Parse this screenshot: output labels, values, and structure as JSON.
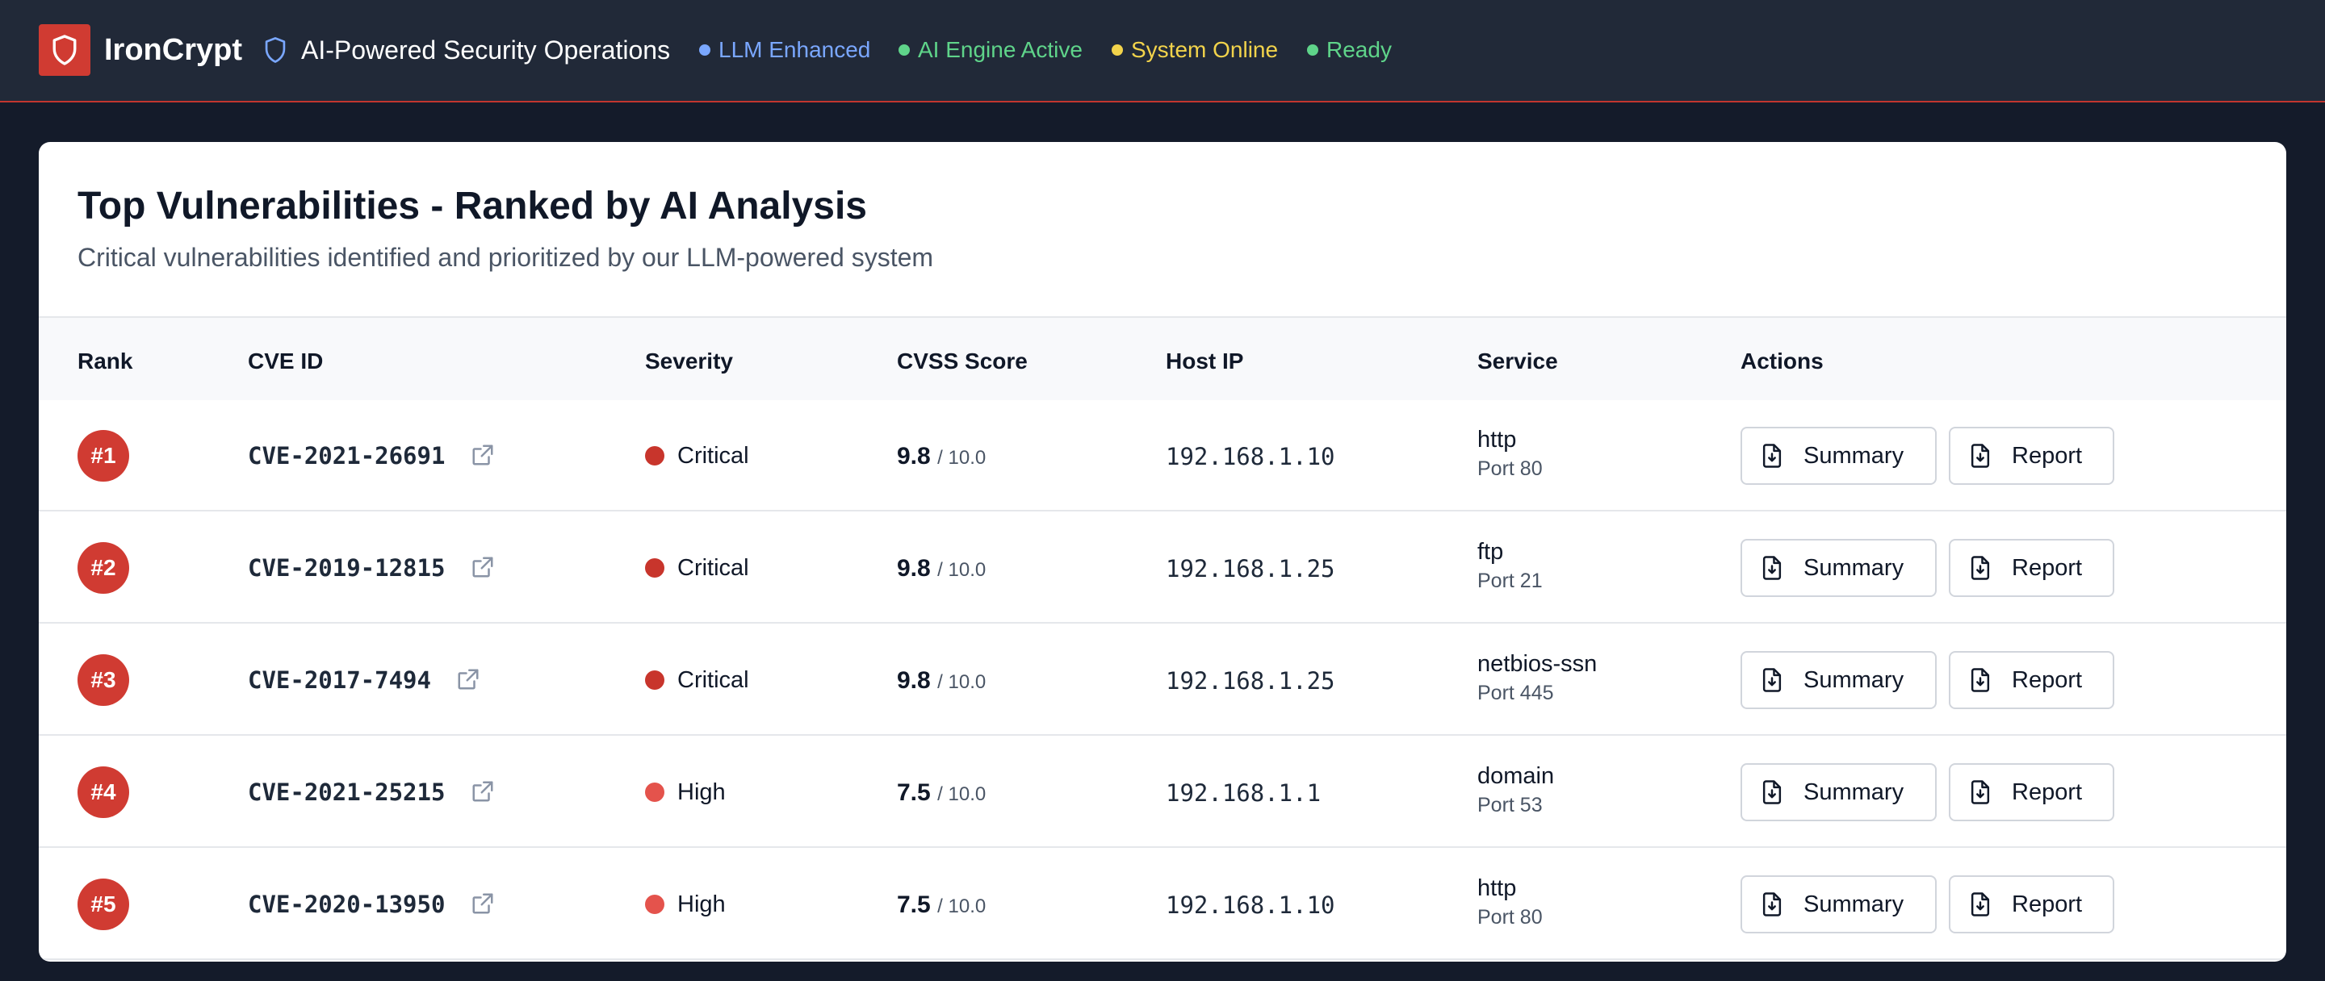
{
  "header": {
    "brand": "IronCrypt",
    "tagline": "AI-Powered Security Operations",
    "statuses": [
      {
        "label": "LLM Enhanced",
        "color": "#7aa7ff"
      },
      {
        "label": "AI Engine Active",
        "color": "#5fd48a"
      },
      {
        "label": "System Online",
        "color": "#f2d34b"
      },
      {
        "label": "Ready",
        "color": "#5fd48a"
      }
    ]
  },
  "card": {
    "title": "Top Vulnerabilities - Ranked by AI Analysis",
    "subtitle": "Critical vulnerabilities identified and prioritized by our LLM-powered system"
  },
  "table": {
    "columns": [
      "Rank",
      "CVE ID",
      "Severity",
      "CVSS Score",
      "Host IP",
      "Service",
      "Actions"
    ],
    "rows": [
      {
        "rank": "#1",
        "cve": "CVE-2021-26691",
        "severity": "Critical",
        "severity_color": "#c8352c",
        "score": "9.8",
        "max": "/ 10.0",
        "ip": "192.168.1.10",
        "service": "http",
        "port": "Port 80",
        "summary": "Summary",
        "report": "Report"
      },
      {
        "rank": "#2",
        "cve": "CVE-2019-12815",
        "severity": "Critical",
        "severity_color": "#c8352c",
        "score": "9.8",
        "max": "/ 10.0",
        "ip": "192.168.1.25",
        "service": "ftp",
        "port": "Port 21",
        "summary": "Summary",
        "report": "Report"
      },
      {
        "rank": "#3",
        "cve": "CVE-2017-7494",
        "severity": "Critical",
        "severity_color": "#c8352c",
        "score": "9.8",
        "max": "/ 10.0",
        "ip": "192.168.1.25",
        "service": "netbios-ssn",
        "port": "Port 445",
        "summary": "Summary",
        "report": "Report"
      },
      {
        "rank": "#4",
        "cve": "CVE-2021-25215",
        "severity": "High",
        "severity_color": "#e4534c",
        "score": "7.5",
        "max": "/ 10.0",
        "ip": "192.168.1.1",
        "service": "domain",
        "port": "Port 53",
        "summary": "Summary",
        "report": "Report"
      },
      {
        "rank": "#5",
        "cve": "CVE-2020-13950",
        "severity": "High",
        "severity_color": "#e4534c",
        "score": "7.5",
        "max": "/ 10.0",
        "ip": "192.168.1.10",
        "service": "http",
        "port": "Port 80",
        "summary": "Summary",
        "report": "Report"
      }
    ]
  },
  "colors": {
    "accent": "#d03b32",
    "header_bg": "#212938",
    "page_bg": "#141b2a"
  },
  "icons": {
    "logo": "shield-icon",
    "tagline": "shield-outline-icon",
    "cve_link": "external-link-icon",
    "download": "file-download-icon"
  }
}
